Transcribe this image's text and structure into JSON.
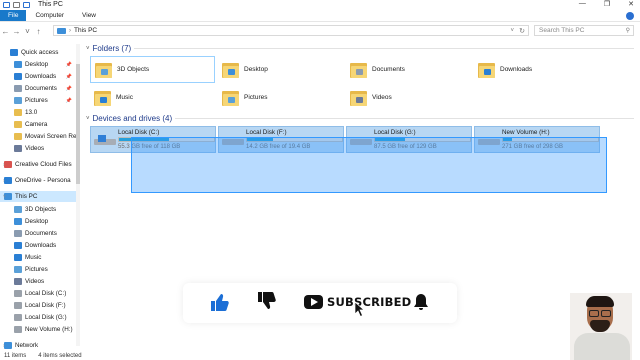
{
  "window": {
    "title": "This PC",
    "controls": [
      "—",
      "❐",
      "✕"
    ]
  },
  "ribbon": {
    "tabs": [
      "File",
      "Computer",
      "View"
    ]
  },
  "address": {
    "nav": [
      "←",
      "→",
      "˅",
      "↑"
    ],
    "path": "This PC",
    "search_placeholder": "Search This PC"
  },
  "sidebar": {
    "items": [
      {
        "label": "Quick access",
        "icon": "star-icon",
        "color": "#2a7fd4"
      },
      {
        "label": "Desktop",
        "icon": "desktop-icon",
        "color": "#3d8fd9",
        "pinned": true
      },
      {
        "label": "Downloads",
        "icon": "download-icon",
        "color": "#2a7fd4",
        "pinned": true
      },
      {
        "label": "Documents",
        "icon": "documents-icon",
        "color": "#8a9bb0",
        "pinned": true
      },
      {
        "label": "Pictures",
        "icon": "pictures-icon",
        "color": "#5aa0d8",
        "pinned": true
      },
      {
        "label": "13.0",
        "icon": "folder-icon",
        "color": "#e8bd4f"
      },
      {
        "label": "Camera",
        "icon": "folder-icon",
        "color": "#e8bd4f"
      },
      {
        "label": "Movavi Screen Re",
        "icon": "folder-icon",
        "color": "#e8bd4f"
      },
      {
        "label": "Videos",
        "icon": "videos-icon",
        "color": "#6b7a99"
      },
      {
        "label": "Creative Cloud Files",
        "icon": "creative-cloud-icon",
        "color": "#d9534f"
      },
      {
        "label": "OneDrive - Persona",
        "icon": "cloud-icon",
        "color": "#2a7fd4"
      },
      {
        "label": "This PC",
        "icon": "pc-icon",
        "color": "#3d8fd9",
        "selected": true
      },
      {
        "label": "3D Objects",
        "icon": "3d-objects-icon",
        "color": "#5aa0d8"
      },
      {
        "label": "Desktop",
        "icon": "desktop-icon",
        "color": "#3d8fd9"
      },
      {
        "label": "Documents",
        "icon": "documents-icon",
        "color": "#8a9bb0"
      },
      {
        "label": "Downloads",
        "icon": "download-icon",
        "color": "#2a7fd4"
      },
      {
        "label": "Music",
        "icon": "music-icon",
        "color": "#2a7fd4"
      },
      {
        "label": "Pictures",
        "icon": "pictures-icon",
        "color": "#5aa0d8"
      },
      {
        "label": "Videos",
        "icon": "videos-icon",
        "color": "#6b7a99"
      },
      {
        "label": "Local Disk (C:)",
        "icon": "drive-icon",
        "color": "#9aa1aa"
      },
      {
        "label": "Local Disk (F:)",
        "icon": "drive-icon",
        "color": "#9aa1aa"
      },
      {
        "label": "Local Disk (G:)",
        "icon": "drive-icon",
        "color": "#9aa1aa"
      },
      {
        "label": "New Volume (H:)",
        "icon": "drive-icon",
        "color": "#9aa1aa"
      },
      {
        "label": "Network",
        "icon": "network-icon",
        "color": "#3d8fd9"
      }
    ]
  },
  "folders_section": {
    "title": "Folders (7)",
    "items": [
      {
        "label": "3D Objects",
        "glyph": "#5aa0d8",
        "selected": true
      },
      {
        "label": "Desktop",
        "glyph": "#3d8fd9"
      },
      {
        "label": "Documents",
        "glyph": "#8a9bb0"
      },
      {
        "label": "Downloads",
        "glyph": "#2a7fd4"
      },
      {
        "label": "Music",
        "glyph": "#2a7fd4"
      },
      {
        "label": "Pictures",
        "glyph": "#5aa0d8"
      },
      {
        "label": "Videos",
        "glyph": "#6b7a99"
      }
    ]
  },
  "drives_section": {
    "title": "Devices and drives (4)",
    "items": [
      {
        "label": "Local Disk (C:)",
        "free": "55.3 GB free of 118 GB",
        "used_fraction": 0.53
      },
      {
        "label": "Local Disk (F:)",
        "free": "14.2 GB free of 19.4 GB",
        "used_fraction": 0.27
      },
      {
        "label": "Local Disk (G:)",
        "free": "87.5 GB free of 129 GB",
        "used_fraction": 0.32
      },
      {
        "label": "New Volume (H:)",
        "free": "271 GB free of 298 GB",
        "used_fraction": 0.09
      }
    ]
  },
  "subscribe_overlay": {
    "label": "SUBSCRIBED"
  },
  "status": {
    "items_count": "11 items",
    "selected": "4 items selected"
  }
}
